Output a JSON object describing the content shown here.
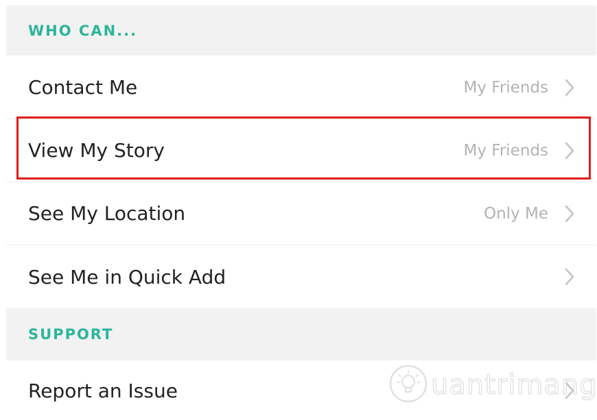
{
  "sections": {
    "who_can": {
      "header": "WHO CAN...",
      "rows": [
        {
          "label": "Contact Me",
          "value": "My Friends"
        },
        {
          "label": "View My Story",
          "value": "My Friends"
        },
        {
          "label": "See My Location",
          "value": "Only Me"
        },
        {
          "label": "See Me in Quick Add",
          "value": ""
        }
      ]
    },
    "support": {
      "header": "SUPPORT",
      "rows": [
        {
          "label": "Report an Issue"
        }
      ]
    }
  },
  "watermark": {
    "text": "uantrimang",
    "logo": "quantrimang-lightbulb-logo"
  },
  "colors": {
    "section_header_text": "#2cb59a",
    "section_header_bg": "#f2f2f2",
    "highlight_border": "#e21b1b",
    "value_text": "#b3b3b3",
    "label_text": "#222222"
  },
  "icons": {
    "row_arrow": "chevron-right-icon"
  }
}
